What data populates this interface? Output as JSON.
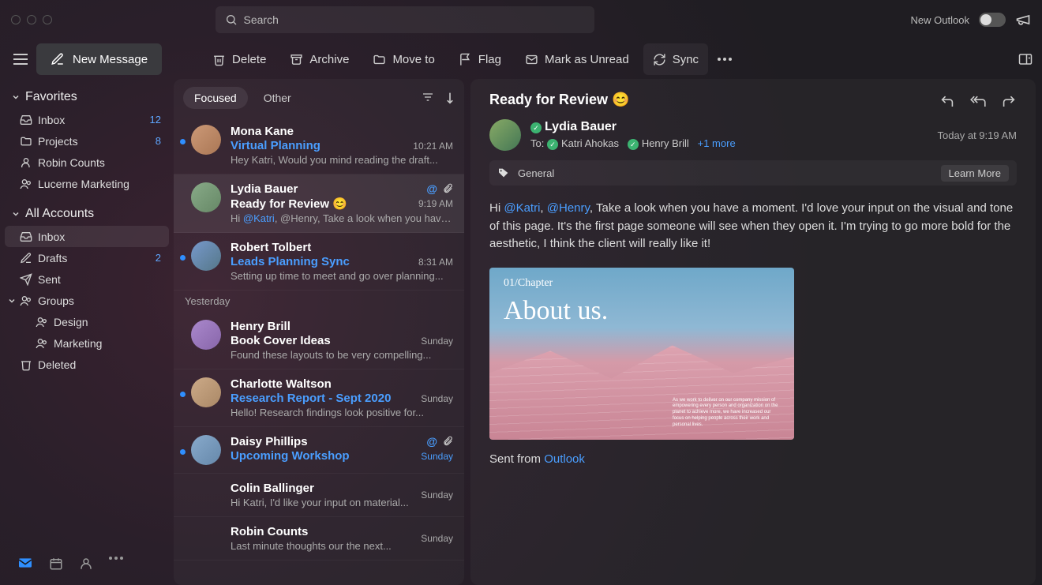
{
  "titlebar": {
    "search_placeholder": "Search",
    "new_outlook": "New Outlook"
  },
  "toolbar": {
    "new_message": "New Message",
    "delete": "Delete",
    "archive": "Archive",
    "move_to": "Move to",
    "flag": "Flag",
    "mark_unread": "Mark as Unread",
    "sync": "Sync"
  },
  "sidebar": {
    "favorites": "Favorites",
    "fav_items": [
      {
        "label": "Inbox",
        "badge": "12"
      },
      {
        "label": "Projects",
        "badge": "8"
      },
      {
        "label": "Robin Counts",
        "badge": ""
      },
      {
        "label": "Lucerne Marketing",
        "badge": ""
      }
    ],
    "all_accounts": "All Accounts",
    "acc_items": [
      {
        "label": "Inbox",
        "badge": ""
      },
      {
        "label": "Drafts",
        "badge": "2"
      },
      {
        "label": "Sent",
        "badge": ""
      },
      {
        "label": "Groups",
        "badge": ""
      }
    ],
    "groups": [
      {
        "label": "Design"
      },
      {
        "label": "Marketing"
      }
    ],
    "deleted": "Deleted"
  },
  "tabs": {
    "focused": "Focused",
    "other": "Other"
  },
  "messages": [
    {
      "from": "Mona Kane",
      "subject": "Virtual Planning",
      "subject_link": true,
      "preview": "Hey Katri, Would you mind reading the draft...",
      "time": "10:21 AM",
      "unread": true,
      "icons": false
    },
    {
      "from": "Lydia Bauer",
      "subject": "Ready for Review 😊",
      "subject_link": false,
      "preview_pre": "Hi ",
      "preview_mention": "@Katri",
      "preview_post": ", @Henry, Take a look when you have...",
      "time": "9:19 AM",
      "unread": false,
      "selected": true,
      "icons": true
    },
    {
      "from": "Robert Tolbert",
      "subject": "Leads Planning Sync",
      "subject_link": true,
      "preview": "Setting up time to meet and go over planning...",
      "time": "8:31 AM",
      "unread": true,
      "icons": false
    }
  ],
  "yesterday": "Yesterday",
  "messages2": [
    {
      "from": "Henry Brill",
      "subject": "Book Cover Ideas",
      "subject_link": false,
      "preview": "Found these layouts to be very compelling...",
      "time": "Sunday",
      "unread": false
    },
    {
      "from": "Charlotte Waltson",
      "subject": "Research Report - Sept 2020",
      "subject_link": true,
      "preview": "Hello! Research findings look positive for...",
      "time": "Sunday",
      "unread": true
    },
    {
      "from": "Daisy Phillips",
      "subject": "Upcoming Workshop",
      "subject_link": true,
      "preview": "",
      "time": "Sunday",
      "unread": true,
      "icons": true,
      "expand": true,
      "time_link": true
    },
    {
      "from": "Colin Ballinger",
      "subject": "",
      "preview": "Hi Katri, I'd like your input on material...",
      "time": "Sunday",
      "noav": true
    },
    {
      "from": "Robin Counts",
      "subject": "",
      "preview": "Last minute thoughts our the next...",
      "time": "Sunday",
      "noav": true
    }
  ],
  "reader": {
    "title": "Ready for Review 😊",
    "sender": "Lydia Bauer",
    "date": "Today at 9:19 AM",
    "to_label": "To:",
    "to1": "Katri Ahokas",
    "to2": "Henry Brill",
    "more": "+1 more",
    "tag": "General",
    "learn_more": "Learn More",
    "body_hi": "Hi ",
    "body_m1": "@Katri",
    "body_c1": ", ",
    "body_m2": "@Henry",
    "body_rest": ", Take a look when you have a moment. I'd love your input on the visual and tone of this page. It's the first page someone will see when they open it. I'm trying to go more bold for the aesthetic, I think the client will really like it!",
    "cover_chapter": "01/Chapter",
    "cover_title": "About us.",
    "cover_blurb": "As we work to deliver on our company mission of empowering every person and organization on the planet to achieve more, we have increased our focus on helping people across their work and personal lives.",
    "sent_from": "Sent from ",
    "outlook": "Outlook"
  }
}
